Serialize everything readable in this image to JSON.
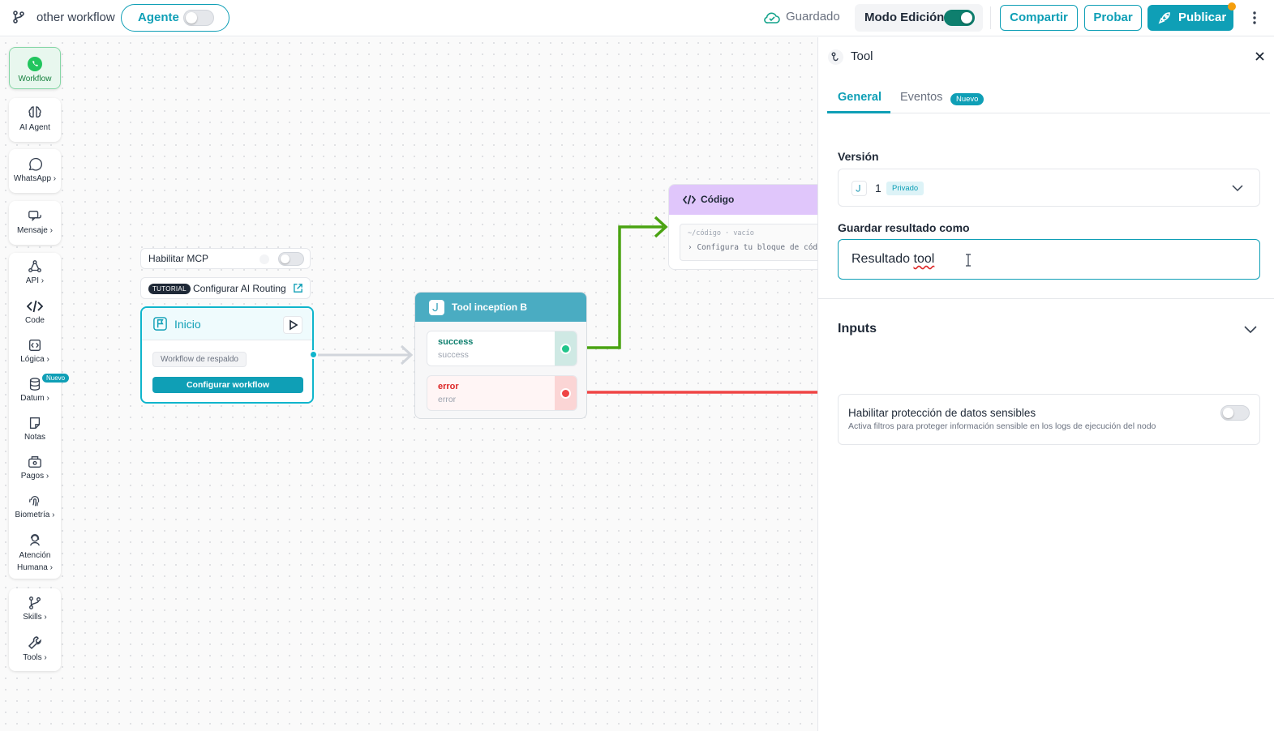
{
  "header": {
    "workflow_name": "other workflow",
    "agent_label": "Agente",
    "agent_enabled": false,
    "saved_status": "Guardado",
    "edit_mode_label": "Modo Edición",
    "edit_mode_enabled": true,
    "share_label": "Compartir",
    "test_label": "Probar",
    "publish_label": "Publicar"
  },
  "sidebar": {
    "items": [
      {
        "label": "Workflow",
        "icon": "whatsapp-icon",
        "active": true
      },
      {
        "label": "AI Agent",
        "icon": "brain-icon"
      },
      {
        "label": "WhatsApp ›",
        "icon": "whatsapp-icon"
      },
      {
        "label": "Mensaje ›",
        "icon": "message-icon"
      },
      {
        "label": "API ›",
        "icon": "api-icon"
      },
      {
        "label": "Code",
        "icon": "code-icon"
      },
      {
        "label": "Lógica ›",
        "icon": "logic-icon"
      },
      {
        "label": "Datum ›",
        "icon": "database-icon",
        "badge": "Nuevo"
      },
      {
        "label": "Notas",
        "icon": "note-icon"
      },
      {
        "label": "Pagos ›",
        "icon": "payment-icon"
      },
      {
        "label": "Biometría ›",
        "icon": "fingerprint-icon"
      },
      {
        "label": "Atención",
        "label2": "Humana ›",
        "icon": "support-agent-icon"
      },
      {
        "label": "Skills ›",
        "icon": "branch-icon"
      },
      {
        "label": "Tools ›",
        "icon": "wrench-icon"
      }
    ]
  },
  "canvas": {
    "mcp_label": "Habilitar MCP",
    "tutorial_badge": "TUTORIAL",
    "tutorial_label": "Configurar AI Routing",
    "start_node": {
      "title": "Inicio",
      "fallback": "Workflow de respaldo",
      "configure_button": "Configurar workflow"
    },
    "tool_node": {
      "title": "Tool inception B",
      "ports": [
        {
          "name": "success",
          "sub": "success"
        },
        {
          "name": "error",
          "sub": "error"
        }
      ]
    },
    "code_node": {
      "title": "Código",
      "line1": "~/código · vacío",
      "line2": "› Configura tu bloque de código"
    }
  },
  "panel": {
    "title": "Tool",
    "tabs": [
      {
        "label": "General",
        "active": true
      },
      {
        "label": "Eventos",
        "badge": "Nuevo"
      }
    ],
    "version_label": "Versión",
    "version_value": "1",
    "version_badge": "Privado",
    "save_as_label": "Guardar resultado como",
    "save_as_value_a": "Resultado ",
    "save_as_value_b": "tool",
    "inputs_title": "Inputs",
    "sensitive_title": "Habilitar protección de datos sensibles",
    "sensitive_desc": "Activa filtros para proteger información sensible en los logs de ejecución del nodo",
    "sensitive_enabled": false
  },
  "colors": {
    "primary": "#0f9fb6",
    "success": "#22c58b",
    "error": "#ef4444",
    "edge_success": "#4aa312",
    "code_header": "#e0c6fb"
  }
}
